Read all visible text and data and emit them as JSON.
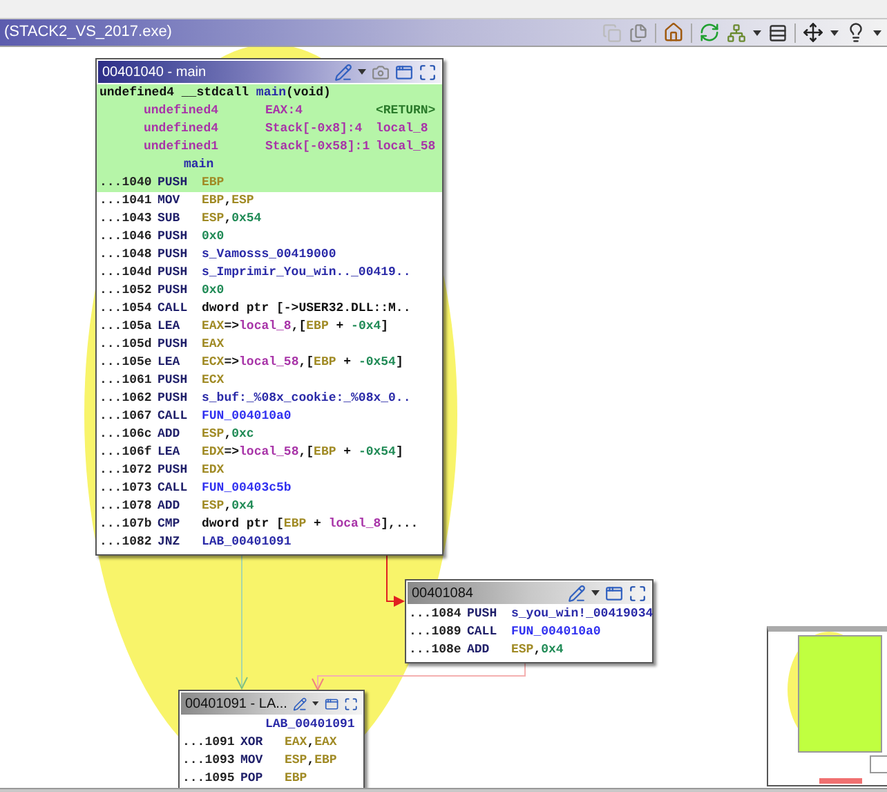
{
  "window": {
    "title": "(STACK2_VS_2017.exe)"
  },
  "graph_nodes": [
    {
      "title": "00401040 - main",
      "focused": true,
      "highlighted": true,
      "signature": [
        {
          "text": "undefined4 __stdcall ",
          "kind": "plain"
        },
        {
          "text": "main",
          "kind": "label"
        },
        {
          "text": "(void)",
          "kind": "plain"
        }
      ],
      "params": [
        {
          "type": "undefined4",
          "storage": "EAX:4",
          "name": "<RETURN>",
          "kind": "return"
        },
        {
          "type": "undefined4",
          "storage": "Stack[-0x8]:4",
          "name": "local_8",
          "kind": "local"
        },
        {
          "type": "undefined1",
          "storage": "Stack[-0x58]:1",
          "name": "local_58",
          "kind": "local"
        }
      ],
      "label": "main",
      "instructions": [
        {
          "address": "...1040",
          "mnemonic": "PUSH",
          "highlighted": true,
          "operands": [
            {
              "text": "EBP",
              "kind": "register"
            }
          ]
        },
        {
          "address": "...1041",
          "mnemonic": "MOV",
          "highlighted": false,
          "operands": [
            {
              "text": "EBP",
              "kind": "register"
            },
            {
              "text": ",",
              "kind": "plain"
            },
            {
              "text": "ESP",
              "kind": "register"
            }
          ]
        },
        {
          "address": "...1043",
          "mnemonic": "SUB",
          "highlighted": false,
          "operands": [
            {
              "text": "ESP",
              "kind": "register"
            },
            {
              "text": ",",
              "kind": "plain"
            },
            {
              "text": "0x54",
              "kind": "scalar"
            }
          ]
        },
        {
          "address": "...1046",
          "mnemonic": "PUSH",
          "highlighted": false,
          "operands": [
            {
              "text": "0x0",
              "kind": "scalar"
            }
          ]
        },
        {
          "address": "...1048",
          "mnemonic": "PUSH",
          "highlighted": false,
          "operands": [
            {
              "text": "s_Vamosss_00419000",
              "kind": "label"
            }
          ]
        },
        {
          "address": "...104d",
          "mnemonic": "PUSH",
          "highlighted": false,
          "operands": [
            {
              "text": "s_Imprimir_You_win.._00419..",
              "kind": "label"
            }
          ]
        },
        {
          "address": "...1052",
          "mnemonic": "PUSH",
          "highlighted": false,
          "operands": [
            {
              "text": "0x0",
              "kind": "scalar"
            }
          ]
        },
        {
          "address": "...1054",
          "mnemonic": "CALL",
          "highlighted": false,
          "operands": [
            {
              "text": "dword ptr [->USER32.DLL::M..",
              "kind": "plain"
            }
          ]
        },
        {
          "address": "...105a",
          "mnemonic": "LEA",
          "highlighted": false,
          "operands": [
            {
              "text": "EAX",
              "kind": "register"
            },
            {
              "text": "=>",
              "kind": "plain"
            },
            {
              "text": "local_8",
              "kind": "variable"
            },
            {
              "text": ",[",
              "kind": "plain"
            },
            {
              "text": "EBP",
              "kind": "register"
            },
            {
              "text": " + ",
              "kind": "plain"
            },
            {
              "text": "-0x4",
              "kind": "scalar"
            },
            {
              "text": "]",
              "kind": "plain"
            }
          ]
        },
        {
          "address": "...105d",
          "mnemonic": "PUSH",
          "highlighted": false,
          "operands": [
            {
              "text": "EAX",
              "kind": "register"
            }
          ]
        },
        {
          "address": "...105e",
          "mnemonic": "LEA",
          "highlighted": false,
          "operands": [
            {
              "text": "ECX",
              "kind": "register"
            },
            {
              "text": "=>",
              "kind": "plain"
            },
            {
              "text": "local_58",
              "kind": "variable"
            },
            {
              "text": ",[",
              "kind": "plain"
            },
            {
              "text": "EBP",
              "kind": "register"
            },
            {
              "text": " + ",
              "kind": "plain"
            },
            {
              "text": "-0x54",
              "kind": "scalar"
            },
            {
              "text": "]",
              "kind": "plain"
            }
          ]
        },
        {
          "address": "...1061",
          "mnemonic": "PUSH",
          "highlighted": false,
          "operands": [
            {
              "text": "ECX",
              "kind": "register"
            }
          ]
        },
        {
          "address": "...1062",
          "mnemonic": "PUSH",
          "highlighted": false,
          "operands": [
            {
              "text": "s_buf:_%08x_cookie:_%08x_0..",
              "kind": "label"
            }
          ]
        },
        {
          "address": "...1067",
          "mnemonic": "CALL",
          "highlighted": false,
          "operands": [
            {
              "text": "FUN_004010a0",
              "kind": "function"
            }
          ]
        },
        {
          "address": "...106c",
          "mnemonic": "ADD",
          "highlighted": false,
          "operands": [
            {
              "text": "ESP",
              "kind": "register"
            },
            {
              "text": ",",
              "kind": "plain"
            },
            {
              "text": "0xc",
              "kind": "scalar"
            }
          ]
        },
        {
          "address": "...106f",
          "mnemonic": "LEA",
          "highlighted": false,
          "operands": [
            {
              "text": "EDX",
              "kind": "register"
            },
            {
              "text": "=>",
              "kind": "plain"
            },
            {
              "text": "local_58",
              "kind": "variable"
            },
            {
              "text": ",[",
              "kind": "plain"
            },
            {
              "text": "EBP",
              "kind": "register"
            },
            {
              "text": " + ",
              "kind": "plain"
            },
            {
              "text": "-0x54",
              "kind": "scalar"
            },
            {
              "text": "]",
              "kind": "plain"
            }
          ]
        },
        {
          "address": "...1072",
          "mnemonic": "PUSH",
          "highlighted": false,
          "operands": [
            {
              "text": "EDX",
              "kind": "register"
            }
          ]
        },
        {
          "address": "...1073",
          "mnemonic": "CALL",
          "highlighted": false,
          "operands": [
            {
              "text": "FUN_00403c5b",
              "kind": "function"
            }
          ]
        },
        {
          "address": "...1078",
          "mnemonic": "ADD",
          "highlighted": false,
          "operands": [
            {
              "text": "ESP",
              "kind": "register"
            },
            {
              "text": ",",
              "kind": "plain"
            },
            {
              "text": "0x4",
              "kind": "scalar"
            }
          ]
        },
        {
          "address": "...107b",
          "mnemonic": "CMP",
          "highlighted": false,
          "operands": [
            {
              "text": "dword ptr [",
              "kind": "plain"
            },
            {
              "text": "EBP",
              "kind": "register"
            },
            {
              "text": " + ",
              "kind": "plain"
            },
            {
              "text": "local_8",
              "kind": "variable"
            },
            {
              "text": "],...",
              "kind": "plain"
            }
          ]
        },
        {
          "address": "...1082",
          "mnemonic": "JNZ",
          "highlighted": false,
          "operands": [
            {
              "text": "LAB_00401091",
              "kind": "label"
            }
          ]
        }
      ]
    },
    {
      "title": "00401084",
      "focused": false,
      "instructions": [
        {
          "address": "...1084",
          "mnemonic": "PUSH",
          "highlighted": false,
          "operands": [
            {
              "text": "s_you_win!_00419034",
              "kind": "label"
            }
          ]
        },
        {
          "address": "...1089",
          "mnemonic": "CALL",
          "highlighted": false,
          "operands": [
            {
              "text": "FUN_004010a0",
              "kind": "function"
            }
          ]
        },
        {
          "address": "...108e",
          "mnemonic": "ADD",
          "highlighted": false,
          "operands": [
            {
              "text": "ESP",
              "kind": "register"
            },
            {
              "text": ",",
              "kind": "plain"
            },
            {
              "text": "0x4",
              "kind": "scalar"
            }
          ]
        }
      ]
    },
    {
      "title": "00401091 - LA...",
      "focused": false,
      "label": "LAB_00401091",
      "instructions": [
        {
          "address": "...1091",
          "mnemonic": "XOR",
          "highlighted": false,
          "operands": [
            {
              "text": "EAX",
              "kind": "register"
            },
            {
              "text": ",",
              "kind": "plain"
            },
            {
              "text": "EAX",
              "kind": "register"
            }
          ]
        },
        {
          "address": "...1093",
          "mnemonic": "MOV",
          "highlighted": false,
          "operands": [
            {
              "text": "ESP",
              "kind": "register"
            },
            {
              "text": ",",
              "kind": "plain"
            },
            {
              "text": "EBP",
              "kind": "register"
            }
          ]
        },
        {
          "address": "...1095",
          "mnemonic": "POP",
          "highlighted": false,
          "operands": [
            {
              "text": "EBP",
              "kind": "register"
            }
          ]
        }
      ]
    }
  ]
}
